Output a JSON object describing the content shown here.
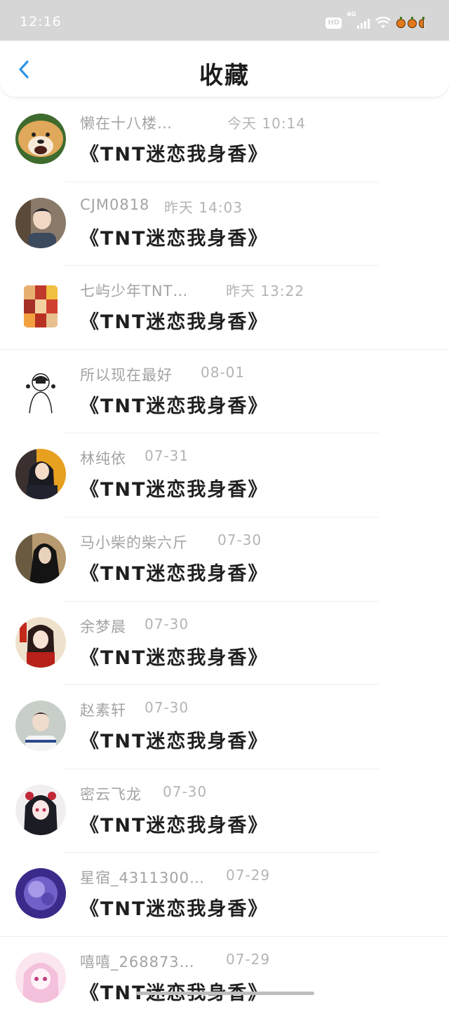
{
  "status_bar": {
    "time": "12:16",
    "hd": "HD",
    "network": "4G"
  },
  "header": {
    "title": "收藏"
  },
  "items": [
    {
      "user": "懒在十八楼…",
      "time": "今天 10:14",
      "title": "《TNT迷恋我身香》",
      "avatar": "shiba-dog"
    },
    {
      "user": "CJM0818",
      "time": "昨天 14:03",
      "title": "《TNT迷恋我身香》",
      "avatar": "boy-photo"
    },
    {
      "user": "七屿少年TNT…",
      "time": "昨天 13:22",
      "title": "《TNT迷恋我身香》",
      "avatar": "photo-collage"
    },
    {
      "user": "所以现在最好",
      "time": "08-01",
      "title": "《TNT迷恋我身香》",
      "avatar": "sketch-girl"
    },
    {
      "user": "林纯依",
      "time": "07-31",
      "title": "《TNT迷恋我身香》",
      "avatar": "girl-dark"
    },
    {
      "user": "马小柴的柴六斤",
      "time": "07-30",
      "title": "《TNT迷恋我身香》",
      "avatar": "girl-longhair"
    },
    {
      "user": "余梦晨",
      "time": "07-30",
      "title": "《TNT迷恋我身香》",
      "avatar": "girl-red"
    },
    {
      "user": "赵素轩",
      "time": "07-30",
      "title": "《TNT迷恋我身香》",
      "avatar": "boy-white"
    },
    {
      "user": "密云飞龙",
      "time": "07-30",
      "title": "《TNT迷恋我身香》",
      "avatar": "anime-girl"
    },
    {
      "user": "星宿_4311300…",
      "time": "07-29",
      "title": "《TNT迷恋我身香》",
      "avatar": "purple-abstract"
    },
    {
      "user": "嘻嘻_268873…",
      "time": "07-29",
      "title": "《TNT迷恋我身香》",
      "avatar": "pink-anime"
    }
  ]
}
